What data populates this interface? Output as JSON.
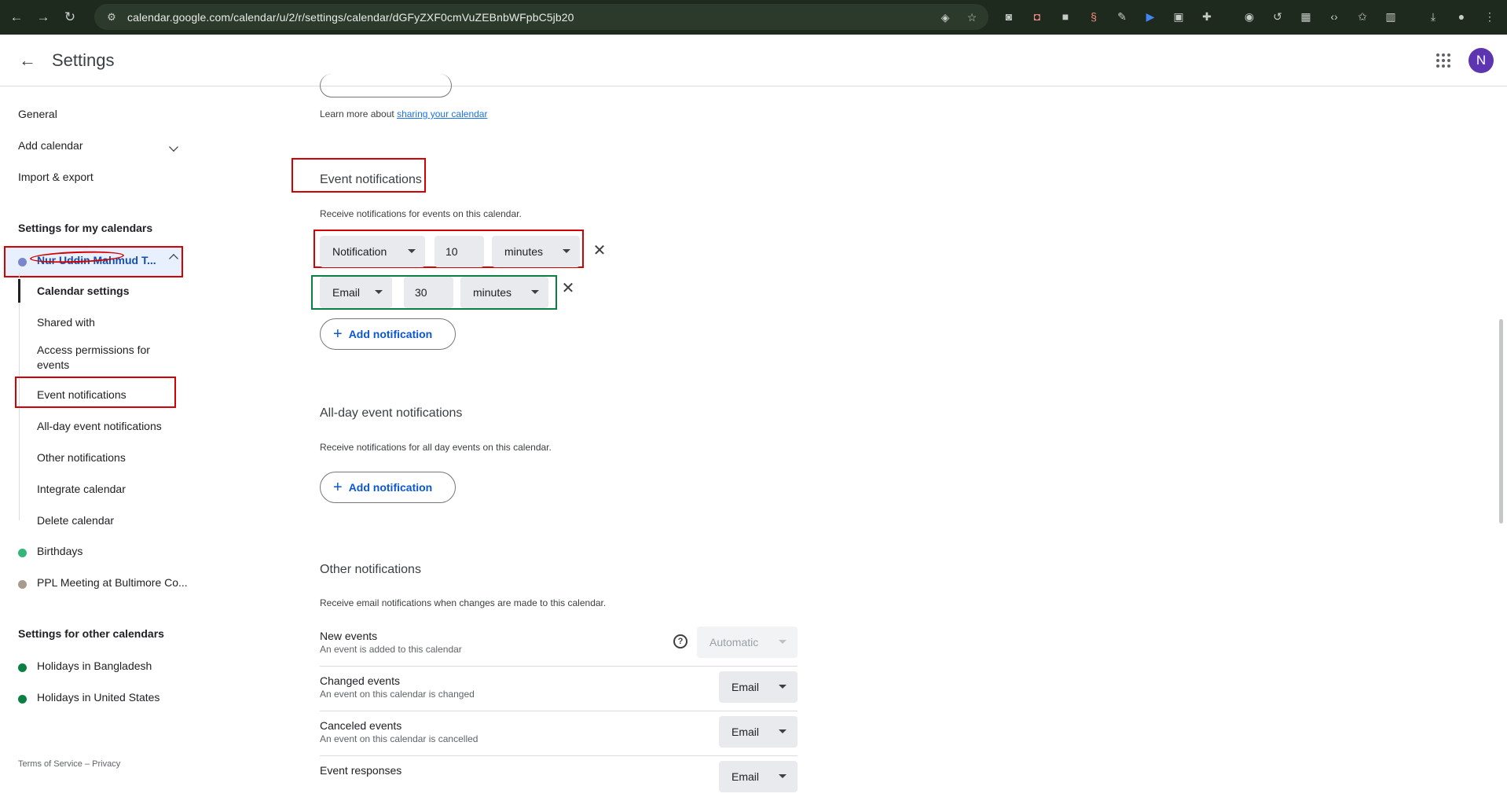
{
  "browser": {
    "url": "calendar.google.com/calendar/u/2/r/settings/calendar/dGFyZXF0cmVuZEBnbWFpbC5jb20"
  },
  "header": {
    "title": "Settings",
    "avatar_letter": "N"
  },
  "sidebar": {
    "general": "General",
    "add_calendar": "Add calendar",
    "import_export": "Import & export",
    "my_calendars_heading": "Settings for my calendars",
    "current_calendar": "Nur Uddin Mahmud T...",
    "sub_items": [
      "Calendar settings",
      "Shared with",
      "Access permissions for events",
      "Event notifications",
      "All-day event notifications",
      "Other notifications",
      "Integrate calendar",
      "Delete calendar"
    ],
    "calendars": [
      {
        "name": "Birthdays",
        "color": "#33b679"
      },
      {
        "name": "PPL Meeting at Bultimore Co...",
        "color": "#a79b8e"
      }
    ],
    "other_calendars_heading": "Settings for other calendars",
    "other_calendars": [
      {
        "name": "Holidays in Bangladesh",
        "color": "#0b8043"
      },
      {
        "name": "Holidays in United States",
        "color": "#0b8043"
      }
    ],
    "footer": "Terms of Service – Privacy"
  },
  "main": {
    "learn_more_prefix": "Learn more about ",
    "learn_more_link": "sharing your calendar",
    "event_notifications": {
      "title": "Event notifications",
      "desc": "Receive notifications for events on this calendar.",
      "rows": [
        {
          "type": "Notification",
          "amount": "10",
          "unit": "minutes"
        },
        {
          "type": "Email",
          "amount": "30",
          "unit": "minutes"
        }
      ],
      "add_label": "Add notification"
    },
    "allday_notifications": {
      "title": "All-day event notifications",
      "desc": "Receive notifications for all day events on this calendar.",
      "add_label": "Add notification"
    },
    "other_notifications": {
      "title": "Other notifications",
      "desc": "Receive email notifications when changes are made to this calendar.",
      "rows": [
        {
          "title": "New events",
          "sub": "An event is added to this calendar",
          "value": "Automatic"
        },
        {
          "title": "Changed events",
          "sub": "An event on this calendar is changed",
          "value": "Email"
        },
        {
          "title": "Canceled events",
          "sub": "An event on this calendar is cancelled",
          "value": "Email"
        },
        {
          "title": "Event responses",
          "sub": "",
          "value": "Email"
        }
      ]
    }
  },
  "colors": {
    "annotation_red": "#d50000",
    "annotation_green": "#0b8043",
    "current_calendar_dot": "#7986cb",
    "accent_blue": "#0b57d0"
  }
}
